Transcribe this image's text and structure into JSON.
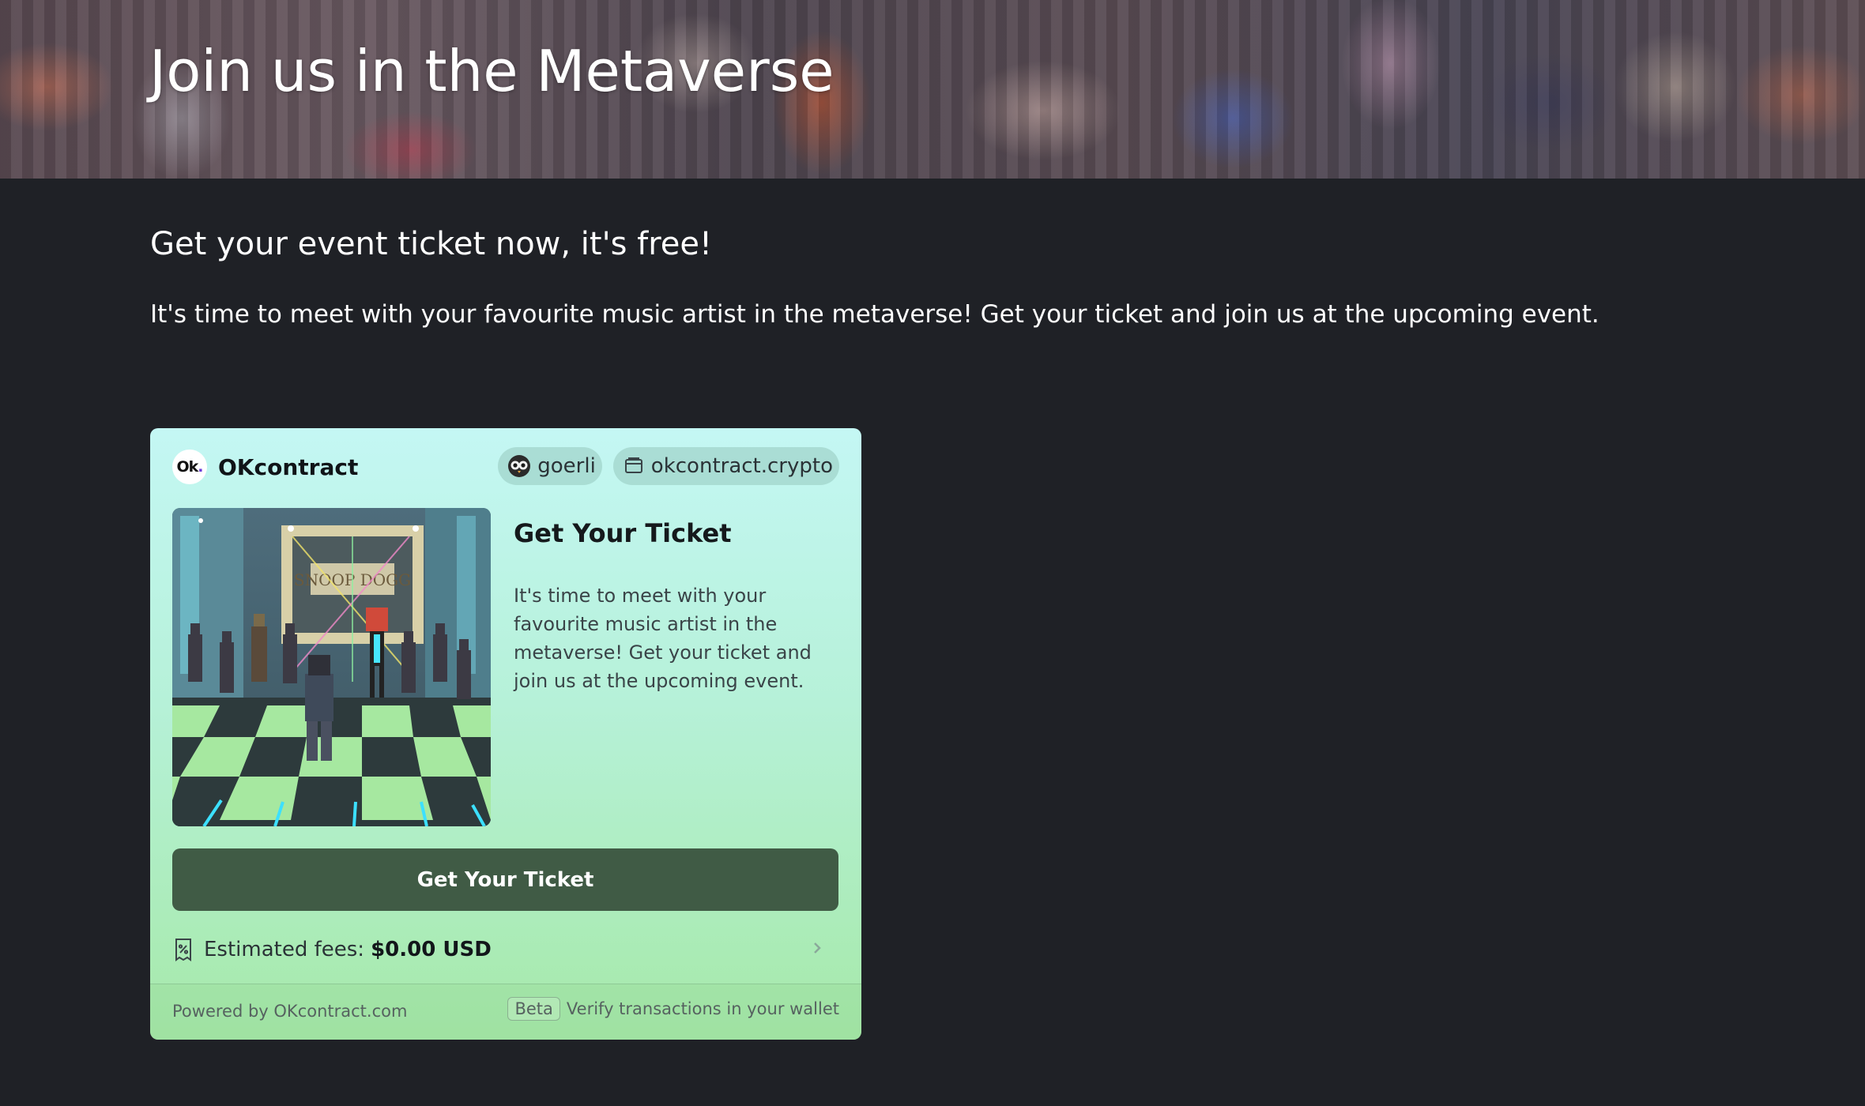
{
  "hero": {
    "title": "Join us in the Metaverse"
  },
  "intro": {
    "subtitle": "Get your event ticket now, it's free!",
    "text": "It's time to meet with your favourite music artist in the metaverse! Get your ticket and join us at the upcoming event."
  },
  "widget": {
    "brand": {
      "logo_text": "Ok",
      "name": "OKcontract"
    },
    "network": {
      "label": "goerli",
      "icon": "owl-icon"
    },
    "account": {
      "label": "okcontract.crypto",
      "icon": "wallet-icon"
    },
    "image": {
      "sign_text": "SNOOP DOGG"
    },
    "product": {
      "title": "Get Your Ticket",
      "description": "It's time to meet with your favourite music artist in the metaverse! Get your ticket and join us at the upcoming event."
    },
    "cta_label": "Get Your Ticket",
    "fees": {
      "label": "Estimated fees:",
      "amount": "$0.00 USD",
      "icon": "receipt-icon"
    },
    "footer": {
      "powered_by": "Powered by OKcontract.com",
      "badge": "Beta",
      "note": "Verify transactions in your wallet"
    }
  },
  "colors": {
    "page_background": "#1f2126",
    "card_gradient_top": "#c4f7f4",
    "card_gradient_bottom": "#a6e9a9",
    "button_background": "#405b45"
  }
}
